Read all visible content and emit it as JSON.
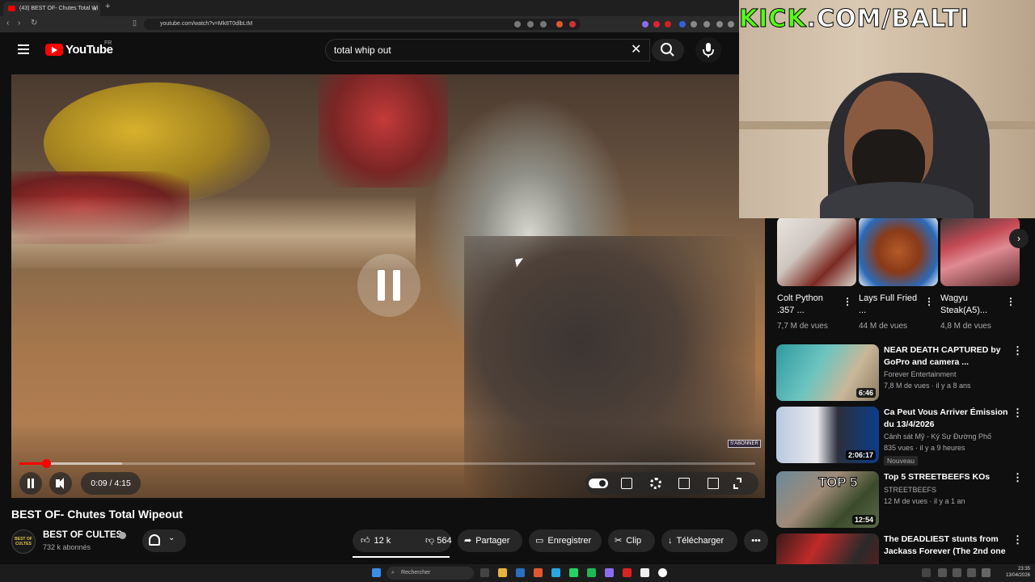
{
  "browser": {
    "tab_title": "(43) BEST OF- Chutes Total Wi",
    "tab_close": "×",
    "new_tab": "+",
    "url": "youtube.com/watch?v=Mk8T0dlbLtM"
  },
  "youtube": {
    "logo_text": "YouTube",
    "country_code": "FR",
    "search_value": "total whip out",
    "clear_glyph": "✕"
  },
  "player": {
    "time": "0:09 / 4:15",
    "progress_fraction": 0.036,
    "buffer_fraction": 0.14,
    "subscribe_watermark": "S'ABONNER",
    "state": "paused-icon-shown"
  },
  "video": {
    "title": "BEST OF- Chutes Total Wipeout",
    "channel_avatar": "BEST OF CULTES",
    "channel_name": "BEST OF CULTES",
    "subscribers": "732 k abonnés",
    "likes": "12 k",
    "dislikes": "564",
    "share_label": "Partager",
    "save_label": "Enregistrer",
    "clip_label": "Clip",
    "download_label": "Télécharger",
    "more_glyph": "•••"
  },
  "overlay": {
    "kick_green": "KICK",
    "kick_rest": ".COM/BALTI"
  },
  "shorts": [
    {
      "title": "Colt Python .357 ...",
      "views": "7,7 M de vues"
    },
    {
      "title": "Lays Full Fried ...",
      "views": "44 M de vues"
    },
    {
      "title": "Wagyu Steak(A5)...",
      "views": "4,8 M de vues"
    }
  ],
  "recommendations": [
    {
      "title": "NEAR DEATH CAPTURED by GoPro and camera ...",
      "channel": "Forever Entertainment",
      "meta": "7,8 M de vues · il y a 8 ans",
      "duration": "6:46"
    },
    {
      "title": "Ca Peut Vous Arriver Émission du 13/4/2026",
      "channel": "Cảnh sát Mỹ - Ký Sự Đường Phố",
      "meta": "835 vues · il y a 9 heures",
      "duration": "2:06:17",
      "badge": "Nouveau"
    },
    {
      "title": "Top 5 STREETBEEFS KOs",
      "channel": "STREETBEEFS",
      "meta": "12 M de vues · il y a 1 an",
      "duration": "12:54",
      "thumb_text": "TOP 5"
    },
    {
      "title": "The DEADLIEST stunts from Jackass Forever (The 2nd one ...",
      "channel": "",
      "meta": ""
    }
  ],
  "taskbar": {
    "search_placeholder": "Rechercher",
    "time": "23:35",
    "date": "13/04/2026"
  },
  "colors": {
    "youtube_red": "#ff0000",
    "kick_green": "#53fc18",
    "background": "#0f0f0f"
  }
}
